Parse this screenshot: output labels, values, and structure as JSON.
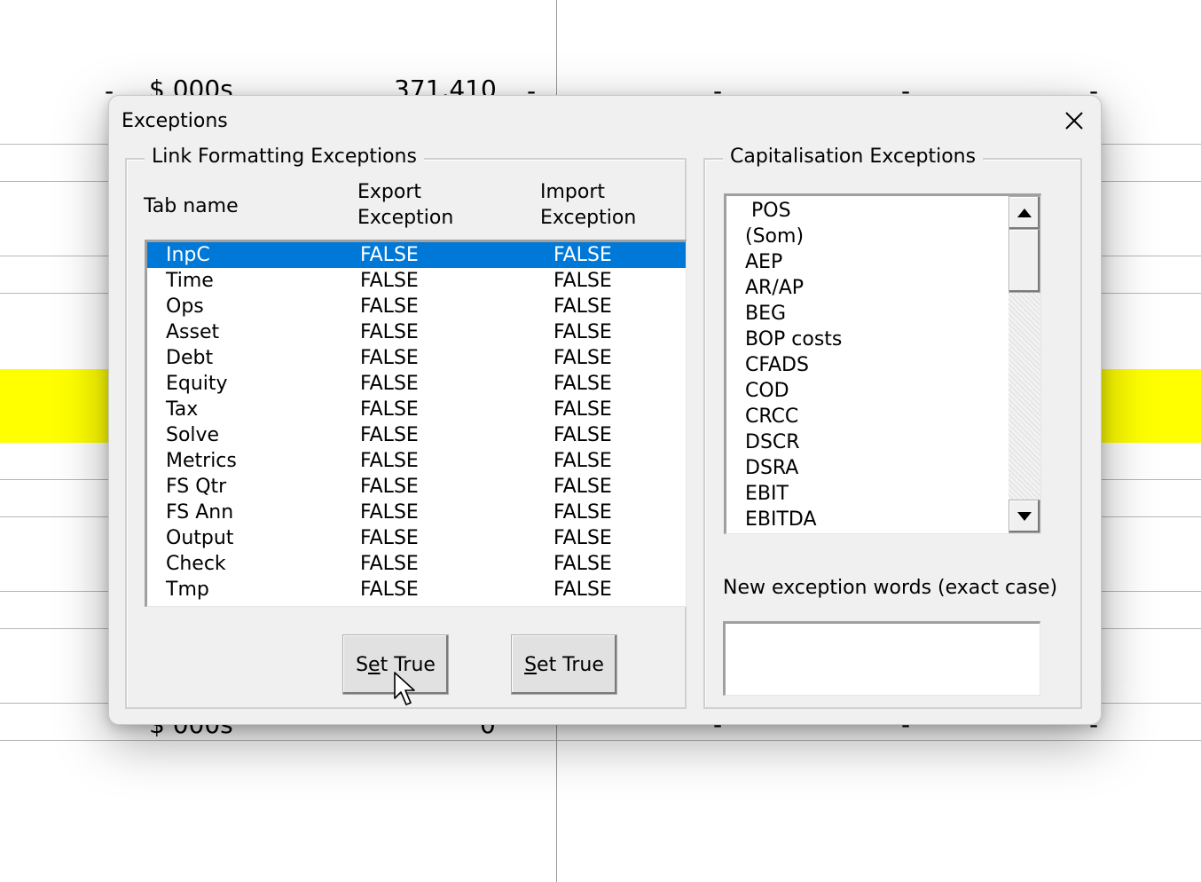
{
  "sheet": {
    "row1": {
      "unit": "$ 000s",
      "value": "371,410"
    },
    "row2": {
      "unit": "$ 000s",
      "value": "0"
    },
    "dash": "-"
  },
  "dialog": {
    "title": "Exceptions",
    "close_icon": "close-icon",
    "link_formatting": {
      "legend": "Link Formatting Exceptions",
      "columns": [
        "Tab name",
        "Export\nException",
        "Import\nException"
      ],
      "col_tab": "Tab name",
      "col_export_1": "Export",
      "col_export_2": "Exception",
      "col_import_1": "Import",
      "col_import_2": "Exception",
      "rows": [
        {
          "tab": "InpC",
          "export": "FALSE",
          "import": "FALSE",
          "selected": true
        },
        {
          "tab": "Time",
          "export": "FALSE",
          "import": "FALSE"
        },
        {
          "tab": "Ops",
          "export": "FALSE",
          "import": "FALSE"
        },
        {
          "tab": "Asset",
          "export": "FALSE",
          "import": "FALSE"
        },
        {
          "tab": "Debt",
          "export": "FALSE",
          "import": "FALSE"
        },
        {
          "tab": "Equity",
          "export": "FALSE",
          "import": "FALSE"
        },
        {
          "tab": "Tax",
          "export": "FALSE",
          "import": "FALSE"
        },
        {
          "tab": "Solve",
          "export": "FALSE",
          "import": "FALSE"
        },
        {
          "tab": "Metrics",
          "export": "FALSE",
          "import": "FALSE"
        },
        {
          "tab": "FS Qtr",
          "export": "FALSE",
          "import": "FALSE"
        },
        {
          "tab": "FS Ann",
          "export": "FALSE",
          "import": "FALSE"
        },
        {
          "tab": "Output",
          "export": "FALSE",
          "import": "FALSE"
        },
        {
          "tab": "Check",
          "export": "FALSE",
          "import": "FALSE"
        },
        {
          "tab": "Tmp",
          "export": "FALSE",
          "import": "FALSE"
        }
      ],
      "button_export": {
        "prefix": "S",
        "accel": "e",
        "rest": "t True"
      },
      "button_import": {
        "prefix": "",
        "accel": "S",
        "rest": "et True"
      }
    },
    "capitalisation": {
      "legend": "Capitalisation Exceptions",
      "items": [
        " POS",
        "(Som)",
        "AEP",
        "AR/AP",
        "BEG",
        "BOP costs",
        "CFADS",
        "COD",
        "CRCC",
        "DSCR",
        "DSRA",
        "EBIT",
        "EBITDA"
      ],
      "new_label": "New exception words (exact case)",
      "new_value": ""
    }
  },
  "colors": {
    "selection": "#0078d7",
    "highlight_row": "#ffff00"
  }
}
